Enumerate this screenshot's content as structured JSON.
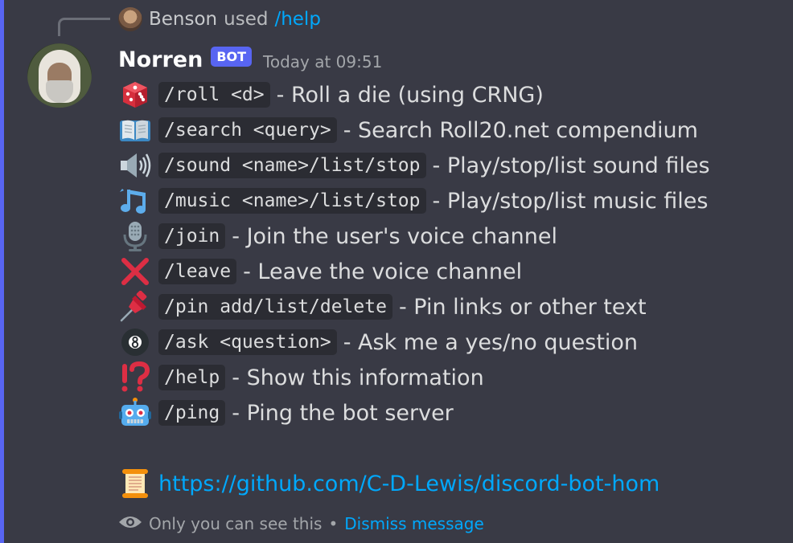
{
  "reply": {
    "user": "Benson",
    "verb": "used",
    "command": "/help"
  },
  "message": {
    "author": "Norren",
    "tag": "BOT",
    "timestamp": "Today at 09:51"
  },
  "commands": [
    {
      "icon": "game-die-icon",
      "code": "/roll <d>",
      "desc": "- Roll a die (using CRNG)"
    },
    {
      "icon": "open-book-icon",
      "code": "/search <query>",
      "desc": "- Search Roll20.net compendium"
    },
    {
      "icon": "speaker-icon",
      "code": "/sound <name>/list/stop",
      "desc": "- Play/stop/list sound files"
    },
    {
      "icon": "music-notes-icon",
      "code": "/music <name>/list/stop",
      "desc": "- Play/stop/list music files"
    },
    {
      "icon": "microphone-icon",
      "code": "/join",
      "desc": "- Join the user's voice channel"
    },
    {
      "icon": "cross-mark-icon",
      "code": "/leave",
      "desc": "- Leave the voice channel"
    },
    {
      "icon": "pushpin-icon",
      "code": "/pin add/list/delete",
      "desc": "- Pin links or other text"
    },
    {
      "icon": "8-ball-icon",
      "code": "/ask <question>",
      "desc": "- Ask me a yes/no question"
    },
    {
      "icon": "exclamation-question-icon",
      "code": "/help",
      "desc": "- Show this information"
    },
    {
      "icon": "robot-icon",
      "code": "/ping",
      "desc": "- Ping the bot server"
    }
  ],
  "link": {
    "icon": "scroll-icon",
    "text": "https://github.com/C-D-Lewis/discord-bot-hom"
  },
  "footer": {
    "visibility_text": "Only you can see this",
    "separator": "•",
    "dismiss_label": "Dismiss message"
  },
  "colors": {
    "background": "#393a45",
    "accent": "#5865f2",
    "link": "#00a8fc",
    "code_bg": "#2b2c33"
  }
}
